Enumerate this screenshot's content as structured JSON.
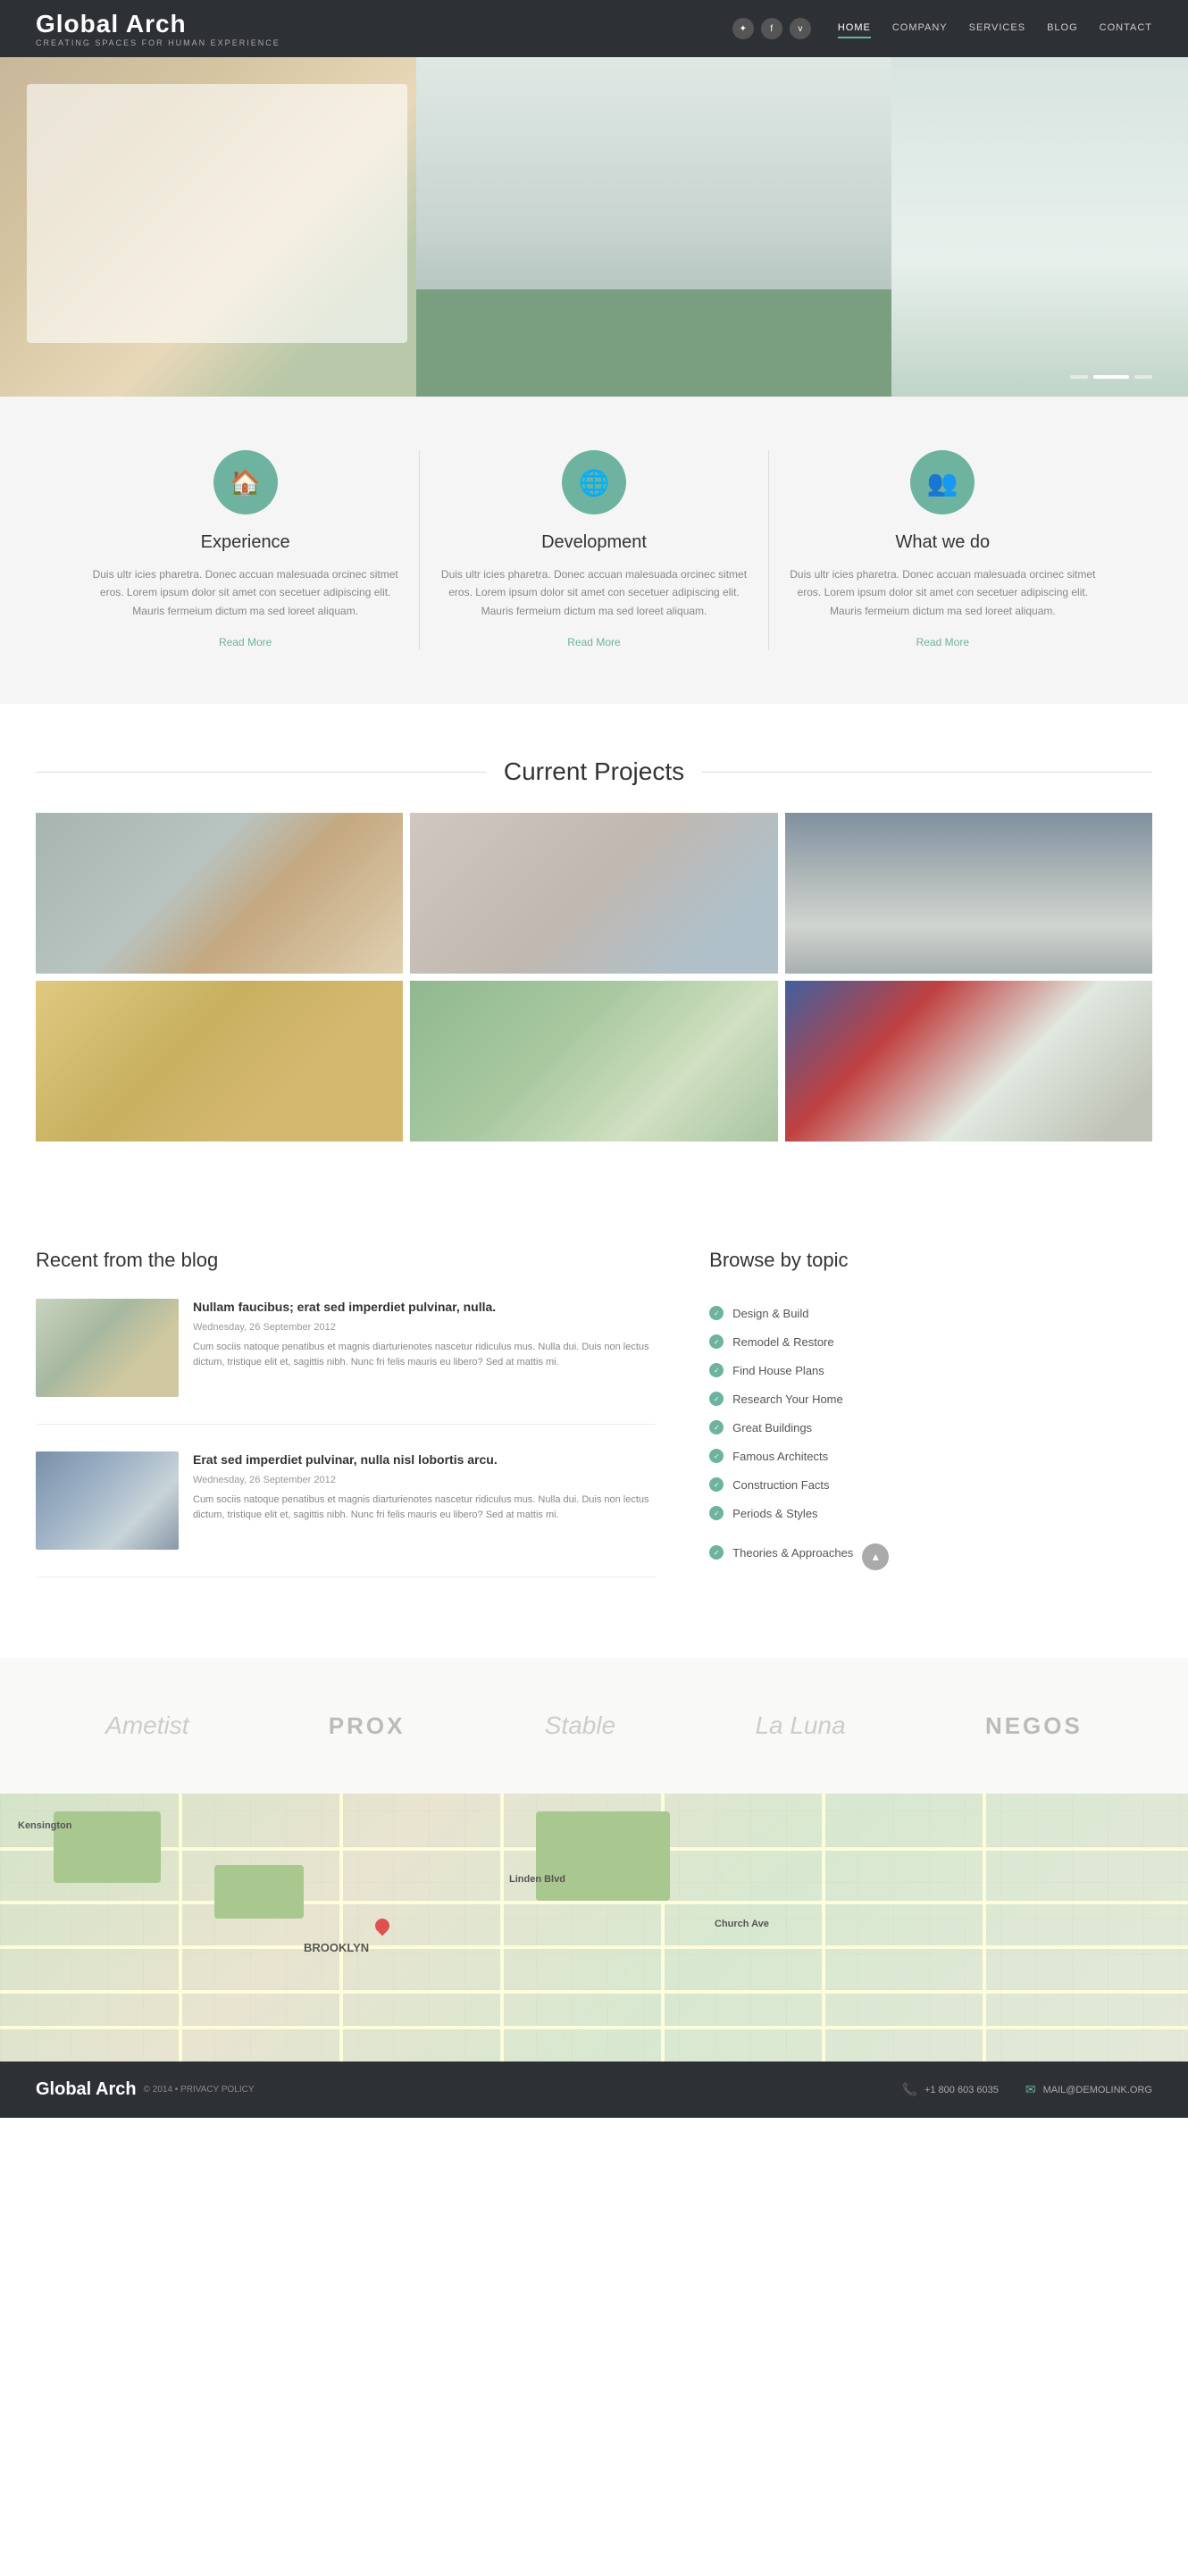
{
  "header": {
    "logo": "Global Arch",
    "tagline": "CREATING SPACES FOR HUMAN EXPERIENCE",
    "nav": [
      {
        "label": "HOME",
        "active": true
      },
      {
        "label": "COMPANY",
        "active": false
      },
      {
        "label": "SERVICES",
        "active": false
      },
      {
        "label": "BLOG",
        "active": false
      },
      {
        "label": "CONTACT",
        "active": false
      }
    ],
    "social": [
      "T",
      "f",
      "V"
    ]
  },
  "features": [
    {
      "icon": "🏠",
      "title": "Experience",
      "desc": "Duis ultr icies pharetra. Donec accuan malesuada orcinec sitmet eros. Lorem ipsum dolor sit amet con secetuer adipiscing elit. Mauris fermeium dictum ma sed loreet aliquam.",
      "link": "Read More"
    },
    {
      "icon": "🌐",
      "title": "Development",
      "desc": "Duis ultr icies pharetra. Donec accuan malesuada orcinec sitmet eros. Lorem ipsum dolor sit amet con secetuer adipiscing elit. Mauris fermeium dictum ma sed loreet aliquam.",
      "link": "Read More"
    },
    {
      "icon": "👥",
      "title": "What we do",
      "desc": "Duis ultr icies pharetra. Donec accuan malesuada orcinec sitmet eros. Lorem ipsum dolor sit amet con secetuer adipiscing elit. Mauris fermeium dictum ma sed loreet aliquam.",
      "link": "Read More"
    }
  ],
  "projects": {
    "title": "Current Projects"
  },
  "blog": {
    "title": "Recent from the blog",
    "posts": [
      {
        "title": "Nullam faucibus; erat sed imperdiet pulvinar, nulla.",
        "date": "Wednesday, 26 September 2012",
        "excerpt": "Cum sociis natoque penatibus et magnis diarturienotes nascetur ridiculus mus. Nulla dui. Duis non lectus dictum, tristique elit et, sagittis nibh. Nunc fri felis mauris eu libero? Sed at mattis mi."
      },
      {
        "title": "Erat sed imperdiet pulvinar, nulla nisl lobortis arcu.",
        "date": "Wednesday, 26 September 2012",
        "excerpt": "Cum sociis natoque penatibus et magnis diarturienotes nascetur ridiculus mus. Nulla dui. Duis non lectus dictum, tristique elit et, sagittis nibh. Nunc fri felis mauris eu libero? Sed at mattis mi."
      }
    ]
  },
  "sidebar": {
    "title": "Browse by topic",
    "items": [
      "Design & Build",
      "Remodel & Restore",
      "Find House Plans",
      "Research Your Home",
      "Great Buildings",
      "Famous Architects",
      "Construction Facts",
      "Periods & Styles",
      "Theories & Approaches"
    ]
  },
  "partners": [
    {
      "name": "Ametist",
      "style": "italic"
    },
    {
      "name": "PROX",
      "style": "bold"
    },
    {
      "name": "Stable",
      "style": "italic"
    },
    {
      "name": "La Luna",
      "style": "italic"
    },
    {
      "name": "NEGOS",
      "style": "bold"
    }
  ],
  "footer": {
    "brand": "Global Arch",
    "copy": "© 2014 • PRIVACY POLICY",
    "phone": "+1 800 603 6035",
    "email": "MAIL@DEMOLINK.ORG"
  }
}
